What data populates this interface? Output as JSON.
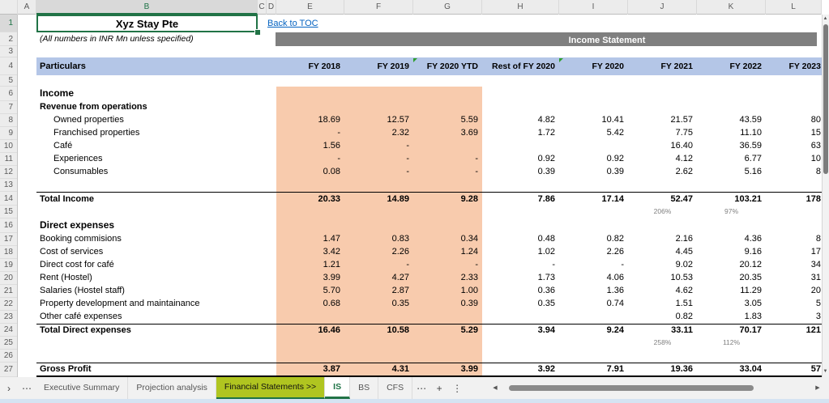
{
  "workbook": {
    "title": "Xyz Stay Pte",
    "subtitle": "(All numbers in INR Mn unless specified)",
    "toc_link": "Back to TOC",
    "banner": "Income Statement"
  },
  "columns": {
    "letters": [
      "A",
      "B",
      "C",
      "D",
      "E",
      "F",
      "G",
      "H",
      "I",
      "J",
      "K",
      "L"
    ]
  },
  "table": {
    "header": {
      "particulars": "Particulars",
      "periods": [
        "FY 2018",
        "FY 2019",
        "FY 2020 YTD",
        "Rest of FY 2020",
        "FY 2020",
        "FY 2021",
        "FY 2022",
        "FY 2023"
      ]
    },
    "rows": [
      {
        "n": "1",
        "style": "chrome",
        "label": "",
        "cells": [
          "",
          "",
          "",
          "",
          "",
          "",
          "",
          ""
        ]
      },
      {
        "n": "2",
        "style": "chrome",
        "label": "",
        "cells": [
          "",
          "",
          "",
          "",
          "",
          "",
          "",
          ""
        ]
      },
      {
        "n": "3",
        "style": "blank",
        "label": "",
        "cells": [
          "",
          "",
          "",
          "",
          "",
          "",
          "",
          ""
        ]
      },
      {
        "n": "4",
        "style": "chrome",
        "label": "",
        "cells": [
          "",
          "",
          "",
          "",
          "",
          "",
          "",
          ""
        ]
      },
      {
        "n": "5",
        "style": "blank",
        "label": "",
        "cells": [
          "",
          "",
          "",
          "",
          "",
          "",
          "",
          ""
        ]
      },
      {
        "n": "6",
        "style": "section",
        "label": "Income",
        "cells": [
          "",
          "",
          "",
          "",
          "",
          "",
          "",
          ""
        ]
      },
      {
        "n": "7",
        "style": "subsection",
        "label": "Revenue from operations",
        "cells": [
          "",
          "",
          "",
          "",
          "",
          "",
          "",
          ""
        ]
      },
      {
        "n": "8",
        "style": "item",
        "label": "Owned properties",
        "cells": [
          "18.69",
          "12.57",
          "5.59",
          "4.82",
          "10.41",
          "21.57",
          "43.59",
          "80"
        ]
      },
      {
        "n": "9",
        "style": "item",
        "label": "Franchised properties",
        "cells": [
          "-",
          "2.32",
          "3.69",
          "1.72",
          "5.42",
          "7.75",
          "11.10",
          "15"
        ]
      },
      {
        "n": "10",
        "style": "item",
        "label": "Café",
        "cells": [
          "1.56",
          "-",
          "",
          "",
          "",
          "16.40",
          "36.59",
          "63"
        ]
      },
      {
        "n": "11",
        "style": "item",
        "label": "Experiences",
        "cells": [
          "-",
          "-",
          "-",
          "0.92",
          "0.92",
          "4.12",
          "6.77",
          "10"
        ]
      },
      {
        "n": "12",
        "style": "item",
        "label": "Consumables",
        "cells": [
          "0.08",
          "-",
          "-",
          "0.39",
          "0.39",
          "2.62",
          "5.16",
          "8"
        ]
      },
      {
        "n": "13",
        "style": "blank",
        "label": "",
        "cells": [
          "",
          "",
          "",
          "",
          "",
          "",
          "",
          ""
        ]
      },
      {
        "n": "14",
        "style": "total",
        "label": "Total Income",
        "cells": [
          "20.33",
          "14.89",
          "9.28",
          "7.86",
          "17.14",
          "52.47",
          "103.21",
          "178"
        ]
      },
      {
        "n": "15",
        "style": "pct",
        "label": "",
        "cells": [
          "",
          "",
          "",
          "",
          "",
          "206%",
          "97%",
          ""
        ]
      },
      {
        "n": "16",
        "style": "section",
        "label": "Direct expenses",
        "cells": [
          "",
          "",
          "",
          "",
          "",
          "",
          "",
          ""
        ]
      },
      {
        "n": "17",
        "style": "plain",
        "label": "Booking commisions",
        "cells": [
          "1.47",
          "0.83",
          "0.34",
          "0.48",
          "0.82",
          "2.16",
          "4.36",
          "8"
        ]
      },
      {
        "n": "18",
        "style": "plain",
        "label": "Cost of services",
        "cells": [
          "3.42",
          "2.26",
          "1.24",
          "1.02",
          "2.26",
          "4.45",
          "9.16",
          "17"
        ]
      },
      {
        "n": "19",
        "style": "plain",
        "label": "Direct cost for café",
        "cells": [
          "1.21",
          "-",
          "-",
          "-",
          "-",
          "9.02",
          "20.12",
          "34"
        ]
      },
      {
        "n": "20",
        "style": "plain",
        "label": "Rent (Hostel)",
        "cells": [
          "3.99",
          "4.27",
          "2.33",
          "1.73",
          "4.06",
          "10.53",
          "20.35",
          "31"
        ]
      },
      {
        "n": "21",
        "style": "plain",
        "label": "Salaries (Hostel staff)",
        "cells": [
          "5.70",
          "2.87",
          "1.00",
          "0.36",
          "1.36",
          "4.62",
          "11.29",
          "20"
        ]
      },
      {
        "n": "22",
        "style": "plain",
        "label": "Property development and maintainance",
        "cells": [
          "0.68",
          "0.35",
          "0.39",
          "0.35",
          "0.74",
          "1.51",
          "3.05",
          "5"
        ]
      },
      {
        "n": "23",
        "style": "plain",
        "label": "Other café expenses",
        "cells": [
          "",
          "",
          "",
          "",
          "",
          "0.82",
          "1.83",
          "3"
        ]
      },
      {
        "n": "24",
        "style": "total",
        "label": "Total Direct expenses",
        "cells": [
          "16.46",
          "10.58",
          "5.29",
          "3.94",
          "9.24",
          "33.11",
          "70.17",
          "121"
        ]
      },
      {
        "n": "25",
        "style": "pct",
        "label": "",
        "cells": [
          "",
          "",
          "",
          "",
          "",
          "258%",
          "112%",
          ""
        ]
      },
      {
        "n": "26",
        "style": "blank",
        "label": "",
        "cells": [
          "",
          "",
          "",
          "",
          "",
          "",
          "",
          ""
        ]
      },
      {
        "n": "27",
        "style": "gross",
        "label": "Gross Profit",
        "cells": [
          "3.87",
          "4.31",
          "3.99",
          "3.92",
          "7.91",
          "19.36",
          "33.04",
          "57"
        ]
      }
    ]
  },
  "sheet_tabs": {
    "tabs": [
      {
        "label": "Executive Summary",
        "state": "normal"
      },
      {
        "label": "Projection analysis",
        "state": "normal"
      },
      {
        "label": "Financial Statements >>",
        "state": "highlight"
      },
      {
        "label": "IS",
        "state": "active"
      },
      {
        "label": "BS",
        "state": "normal"
      },
      {
        "label": "CFS",
        "state": "normal"
      }
    ]
  },
  "icons": {
    "chevron_right": "›",
    "ellipsis": "⋯",
    "add": "+",
    "menu": "⋮",
    "left_arrow": "◀",
    "right_arrow": "▶",
    "up_arrow": "▲",
    "down_arrow": "▼"
  },
  "colors": {
    "highlight_orange": "#F8CBAD",
    "header_blue": "#B4C6E7",
    "banner_gray": "#7F7F7F",
    "excel_green": "#217346",
    "tab_green": "#B0C520",
    "link_blue": "#0563C1"
  }
}
